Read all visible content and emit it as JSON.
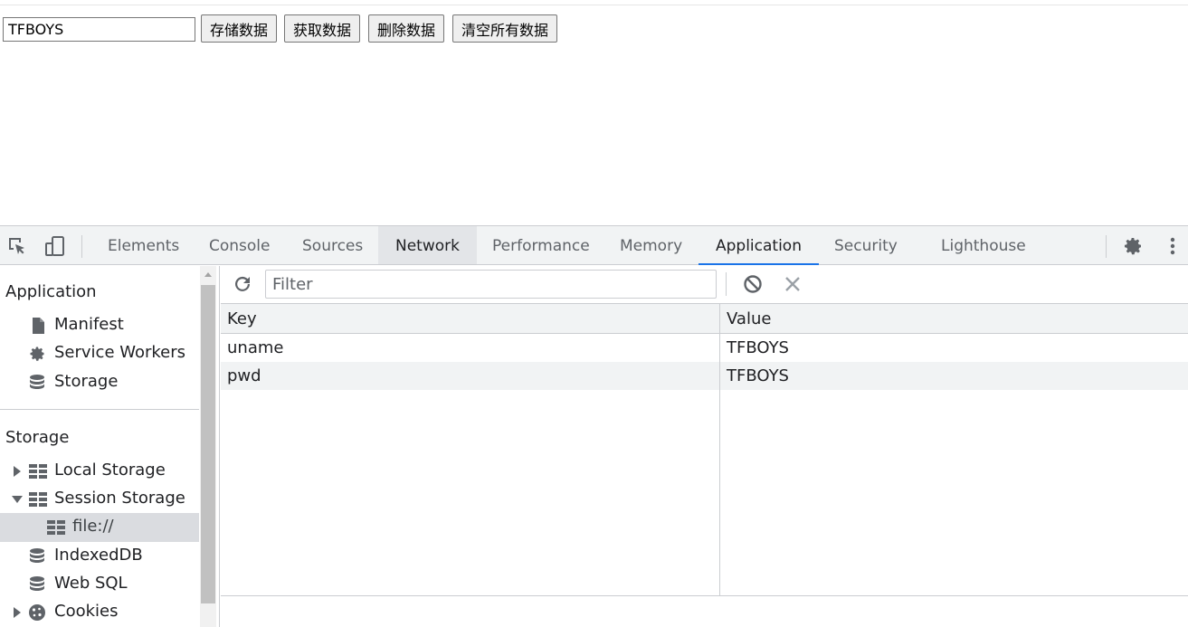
{
  "page": {
    "input_value": "TFBOYS",
    "buttons": [
      "存储数据",
      "获取数据",
      "删除数据",
      "清空所有数据"
    ]
  },
  "devtools": {
    "tabs": [
      "Elements",
      "Console",
      "Sources",
      "Network",
      "Performance",
      "Memory",
      "Application",
      "Security",
      "Lighthouse"
    ],
    "active_tab": "Application",
    "hovered_tab": "Network",
    "icons": [
      "inspect-element-icon",
      "device-toggle-icon",
      "settings-gear-icon",
      "more-options-icon"
    ]
  },
  "sidebar": {
    "sections": [
      {
        "title": "Application",
        "items": [
          {
            "label": "Manifest",
            "icon": "file-icon"
          },
          {
            "label": "Service Workers",
            "icon": "gear-icon"
          },
          {
            "label": "Storage",
            "icon": "database-icon"
          }
        ]
      },
      {
        "title": "Storage",
        "items": [
          {
            "label": "Local Storage",
            "icon": "table-icon",
            "expanded": false
          },
          {
            "label": "Session Storage",
            "icon": "table-icon",
            "expanded": true
          },
          {
            "label": "file://",
            "icon": "table-icon",
            "selected": true
          },
          {
            "label": "IndexedDB",
            "icon": "database-icon"
          },
          {
            "label": "Web SQL",
            "icon": "database-icon"
          },
          {
            "label": "Cookies",
            "icon": "cookie-icon",
            "expanded": false
          }
        ]
      }
    ]
  },
  "storage_panel": {
    "filter_placeholder": "Filter",
    "columns": [
      "Key",
      "Value"
    ],
    "rows": [
      {
        "key": "uname",
        "value": "TFBOYS"
      },
      {
        "key": "pwd",
        "value": "TFBOYS"
      }
    ],
    "toolbar_icons": [
      "refresh-icon",
      "clear-all-icon",
      "delete-selected-icon"
    ]
  },
  "colors": {
    "accent": "#1a73e8",
    "toolbar_bg": "#f1f3f4",
    "border": "#cbcdd1",
    "selected_row": "#dadce0"
  }
}
